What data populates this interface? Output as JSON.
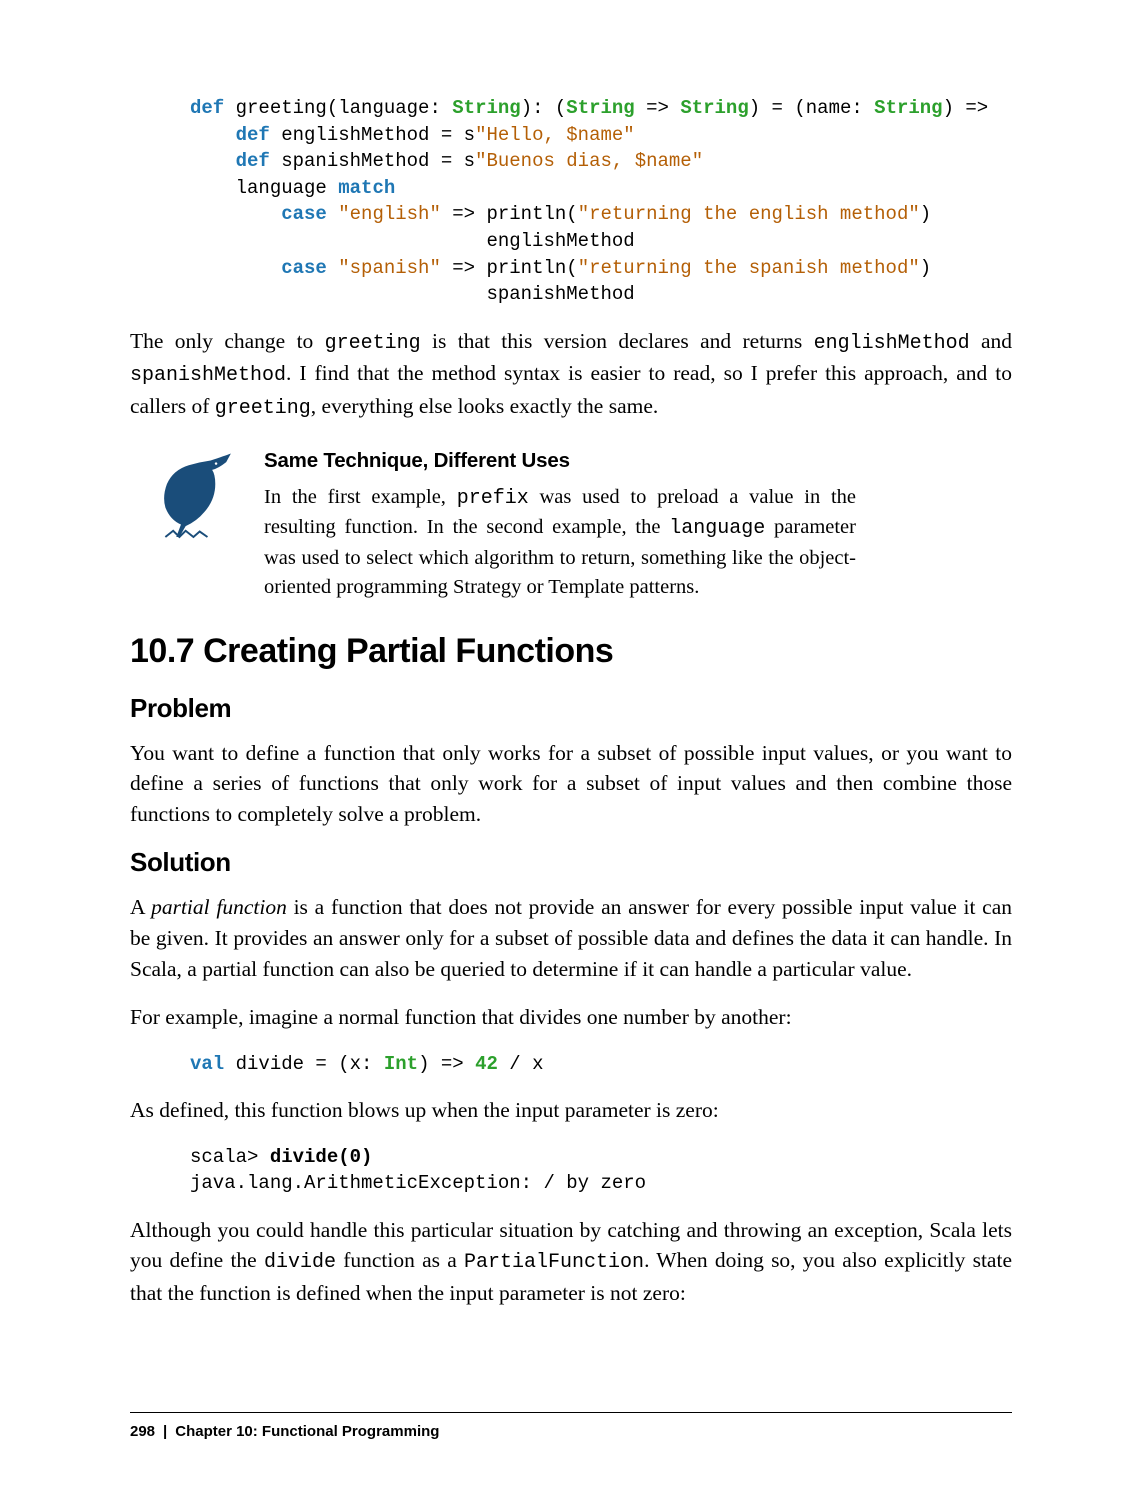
{
  "code": {
    "greeting": "<span class=\"kw\">def</span> greeting(language: <span class=\"typ\">String</span>): (<span class=\"typ\">String</span> =&gt; <span class=\"typ\">String</span>) = (name: <span class=\"typ\">String</span>) =&gt;\n    <span class=\"kw\">def</span> englishMethod = s<span class=\"str\">\"Hello, $name\"</span>\n    <span class=\"kw\">def</span> spanishMethod = s<span class=\"str\">\"Buenos dias, $name\"</span>\n    language <span class=\"kw2\">match</span>\n        <span class=\"kw2\">case</span> <span class=\"str\">\"english\"</span> =&gt; println(<span class=\"str\">\"returning the english method\"</span>)\n                          englishMethod\n        <span class=\"kw2\">case</span> <span class=\"str\">\"spanish\"</span> =&gt; println(<span class=\"str\">\"returning the spanish method\"</span>)\n                          spanishMethod",
    "divide": "<span class=\"kw\">val</span> divide = (x: <span class=\"typ\">Int</span>) =&gt; <span class=\"num\">42</span> / x",
    "divideCall": "scala&gt; <span class=\"bold\">divide(0)</span>\njava.lang.ArithmeticException: / by zero"
  },
  "paras": {
    "p1a": "The only change to ",
    "p1_greeting": "greeting",
    "p1b": " is that this version declares and returns ",
    "p1_em": "englishMethod",
    "p1c": " and ",
    "p1_sm": "spanishMethod",
    "p1d": ". I find that the method syntax is easier to read, so I prefer this approach, and to callers of ",
    "p1_greeting2": "greeting",
    "p1e": ", everything else looks exactly the same.",
    "note_title": "Same Technique, Different Uses",
    "note_a": "In the first example, ",
    "note_prefix": "prefix",
    "note_b": " was used to preload a value in the resulting function. In the second example, the ",
    "note_lang": "language",
    "note_c": " parameter was used to select which algorithm to return, something like the object-oriented programming Strategy or Template patterns.",
    "section": "10.7 Creating Partial Functions",
    "problem_h": "Problem",
    "problem_p": "You want to define a function that only works for a subset of possible input values, or you want to define a series of functions that only work for a subset of input values and then combine those functions to completely solve a problem.",
    "solution_h": "Solution",
    "sol1a": "A ",
    "sol1_em": "partial function",
    "sol1b": " is a function that does not provide an answer for every possible input value it can be given. It provides an answer only for a subset of possible data and defines the data it can handle. In Scala, a partial function can also be queried to determine if it can handle a particular value.",
    "sol2": "For example, imagine a normal function that divides one number by another:",
    "sol3": "As defined, this function blows up when the input parameter is zero:",
    "sol4a": "Although you could handle this particular situation by catching and throwing an exception, Scala lets you define the ",
    "sol4_div": "divide",
    "sol4b": " function as a ",
    "sol4_pf": "PartialFunction",
    "sol4c": ". When doing so, you also explicitly state that the function is defined when the input parameter is not zero:"
  },
  "footer": {
    "page": "298",
    "chapter": "Chapter 10: Functional Programming"
  }
}
